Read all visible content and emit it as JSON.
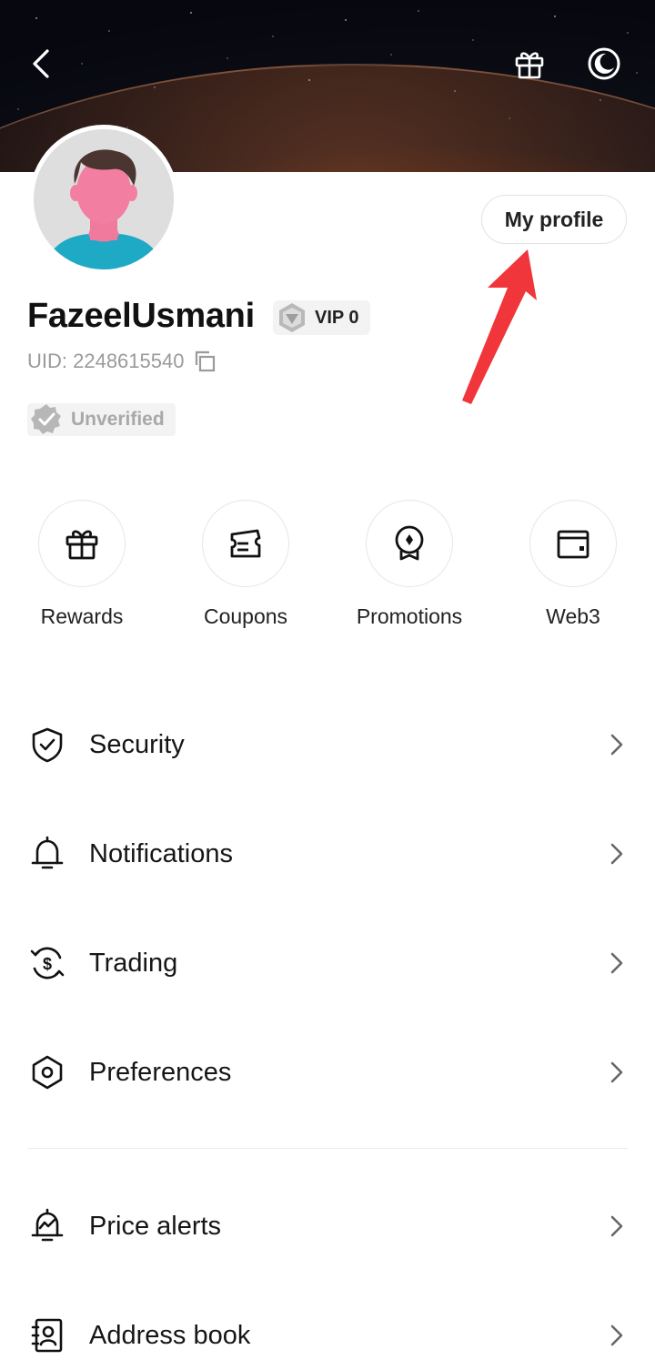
{
  "header": {
    "back_icon": "chevron-left-icon",
    "gift_icon": "gift-icon",
    "theme_icon": "moon-icon"
  },
  "profile": {
    "my_profile_label": "My profile",
    "username": "FazeelUsmani",
    "vip_label": "VIP 0",
    "uid_text": "UID: 2248615540",
    "verification_status": "Unverified"
  },
  "quick_actions": [
    {
      "label": "Rewards",
      "icon": "gift-icon"
    },
    {
      "label": "Coupons",
      "icon": "ticket-icon"
    },
    {
      "label": "Promotions",
      "icon": "medal-icon"
    },
    {
      "label": "Web3",
      "icon": "wallet-icon"
    }
  ],
  "menu": [
    {
      "label": "Security",
      "icon": "shield-check-icon"
    },
    {
      "label": "Notifications",
      "icon": "bell-icon"
    },
    {
      "label": "Trading",
      "icon": "dollar-exchange-icon"
    },
    {
      "label": "Preferences",
      "icon": "hexagon-settings-icon"
    },
    {
      "label": "Price alerts",
      "icon": "price-alert-icon"
    },
    {
      "label": "Address book",
      "icon": "address-book-icon"
    }
  ],
  "colors": {
    "annotation_arrow": "#f0363a",
    "text_primary": "#161616",
    "text_muted": "#9a9a9a"
  }
}
